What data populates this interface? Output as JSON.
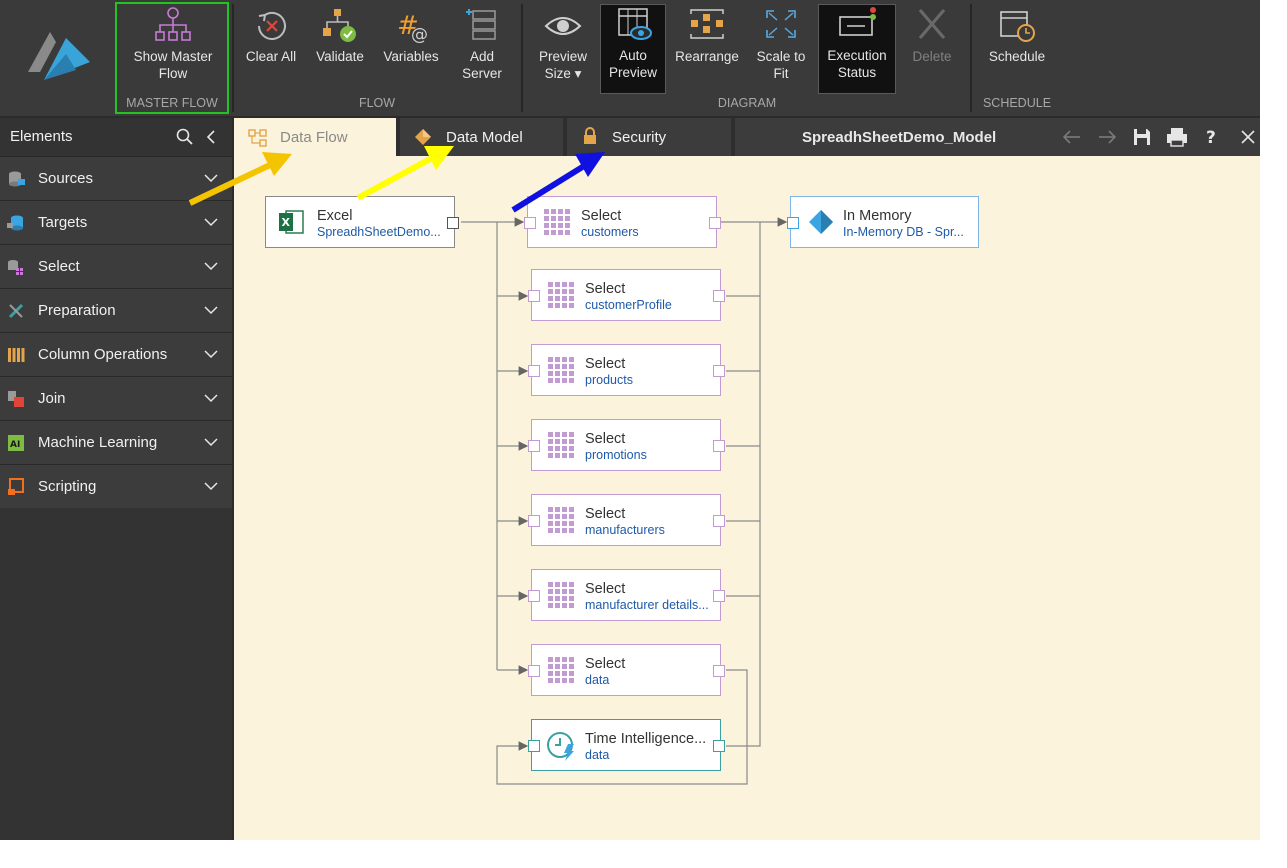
{
  "ribbon": {
    "master_flow": {
      "button": "Show Master\nFlow",
      "group": "MASTER FLOW"
    },
    "flow": {
      "clear_all": "Clear All",
      "validate": "Validate",
      "variables": "Variables",
      "add_server": "Add\nServer",
      "group": "FLOW"
    },
    "diagram": {
      "preview_size": "Preview\nSize ▾",
      "auto_preview": "Auto\nPreview",
      "rearrange": "Rearrange",
      "scale_to_fit": "Scale to\nFit",
      "execution_status": "Execution\nStatus",
      "delete": "Delete",
      "group": "DIAGRAM"
    },
    "schedule": {
      "button": "Schedule",
      "group": "SCHEDULE"
    }
  },
  "sidebar": {
    "title": "Elements",
    "items": [
      {
        "label": "Sources"
      },
      {
        "label": "Targets"
      },
      {
        "label": "Select"
      },
      {
        "label": "Preparation"
      },
      {
        "label": "Column Operations"
      },
      {
        "label": "Join"
      },
      {
        "label": "Machine Learning"
      },
      {
        "label": "Scripting"
      }
    ]
  },
  "tabs": {
    "data_flow": "Data Flow",
    "data_model": "Data Model",
    "security": "Security",
    "model_name": "SpreadhSheetDemo_Model"
  },
  "nodes": {
    "excel": {
      "title": "Excel",
      "sub": "SpreadhSheetDemo..."
    },
    "memory": {
      "title": "In Memory",
      "sub": "In-Memory DB - Spr..."
    },
    "time": {
      "title": "Time Intelligence...",
      "sub": "data"
    },
    "selects": [
      {
        "title": "Select",
        "sub": "customers"
      },
      {
        "title": "Select",
        "sub": "customerProfile"
      },
      {
        "title": "Select",
        "sub": "products"
      },
      {
        "title": "Select",
        "sub": "promotions"
      },
      {
        "title": "Select",
        "sub": "manufacturers"
      },
      {
        "title": "Select",
        "sub": "manufacturer details..."
      },
      {
        "title": "Select",
        "sub": "data"
      }
    ]
  },
  "colors": {
    "accent_green": "#22c51f",
    "canvas": "#fbf3dc",
    "select_border": "#c39bd3",
    "memory_border": "#7fb4e6",
    "time_border": "#3aa0a0",
    "arrow_orange": "#f5c400",
    "arrow_yellow": "#ffff00",
    "arrow_blue": "#1010e0"
  }
}
